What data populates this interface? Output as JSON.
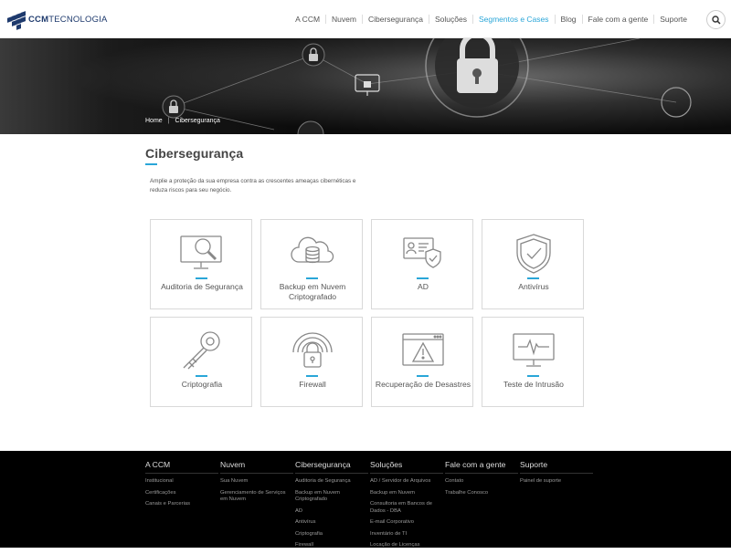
{
  "brand": {
    "logo_bold": "CCM",
    "logo_rest": "TECNOLOGIA"
  },
  "nav": [
    {
      "label": "A CCM",
      "active": false
    },
    {
      "label": "Nuvem",
      "active": false
    },
    {
      "label": "Cibersegurança",
      "active": false
    },
    {
      "label": "Soluções",
      "active": false
    },
    {
      "label": "Segmentos e Cases",
      "active": true
    },
    {
      "label": "Blog",
      "active": false
    },
    {
      "label": "Fale com a gente",
      "active": false
    },
    {
      "label": "Suporte",
      "active": false
    }
  ],
  "breadcrumb": {
    "home": "Home",
    "current": "Cibersegurança",
    "separator": "|"
  },
  "page": {
    "title": "Cibersegurança",
    "intro": "Amplie a proteção da sua empresa contra as crescentes ameaças cibernéticas e reduza riscos para seu negócio."
  },
  "cards": [
    {
      "label": "Auditoria de Segurança",
      "icon": "monitor-search-icon"
    },
    {
      "label": "Backup em Nuvem Criptografado",
      "icon": "cloud-database-icon"
    },
    {
      "label": "AD",
      "icon": "id-card-shield-icon"
    },
    {
      "label": "Antivírus",
      "icon": "shield-check-icon"
    },
    {
      "label": "Criptografia",
      "icon": "key-icon"
    },
    {
      "label": "Firewall",
      "icon": "padlock-wifi-icon"
    },
    {
      "label": "Recuperação de Desastres",
      "icon": "browser-warning-icon"
    },
    {
      "label": "Teste de Intrusão",
      "icon": "monitor-pulse-icon"
    }
  ],
  "footer": [
    {
      "title": "A CCM",
      "links": [
        "Institucional",
        "Certificações",
        "Canais e Parcerias"
      ]
    },
    {
      "title": "Nuvem",
      "links": [
        "Sua Nuvem",
        "Gerenciamento de Serviços em Nuvem"
      ]
    },
    {
      "title": "Cibersegurança",
      "links": [
        "Auditoria de Segurança",
        "Backup em Nuvem Criptografado",
        "AD",
        "Antivírus",
        "Criptografia",
        "Firewall"
      ]
    },
    {
      "title": "Soluções",
      "links": [
        "AD / Servidor de Arquivos",
        "Backup em Nuvem",
        "Consultoria em Bancos de Dados - DBA",
        "E-mail Corporativo",
        "Inventário de TI",
        "Locação de Licenças"
      ]
    },
    {
      "title": "Fale com a gente",
      "links": [
        "Contato",
        "Trabalhe Conosco"
      ]
    },
    {
      "title": "Suporte",
      "links": [
        "Painel de suporte"
      ]
    }
  ],
  "colors": {
    "accent": "#2aa6d8",
    "brand": "#1e3a6d",
    "footer_bg": "#000000"
  }
}
